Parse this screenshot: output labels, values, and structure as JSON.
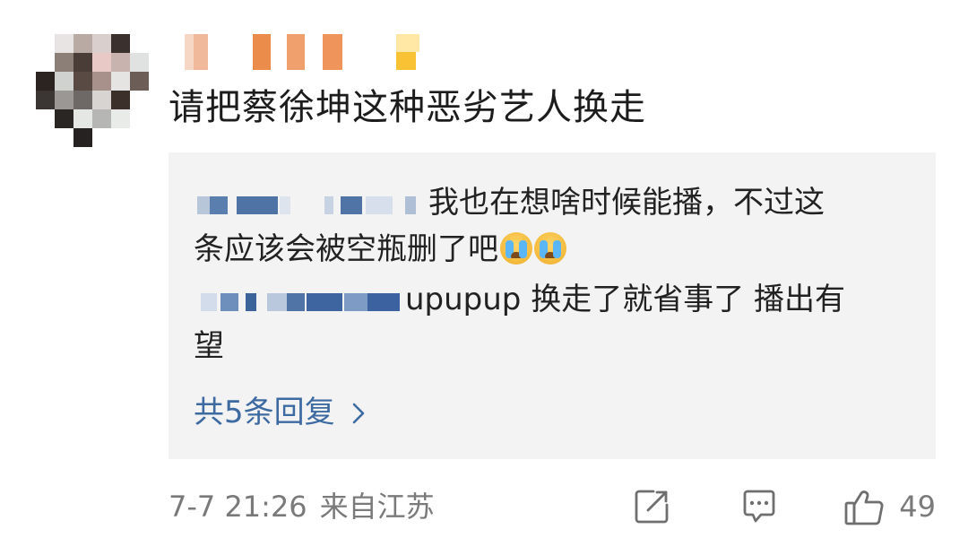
{
  "comment": {
    "text": "请把蔡徐坤这种恶劣艺人换走"
  },
  "replies": [
    {
      "text_line1": "我也在想啥时候能播，不过这",
      "text_line2": "条应该会被空瓶删了吧",
      "emoji": "crying-face-icon"
    },
    {
      "text_line1": "upupup 换走了就省事了 播出有",
      "text_line2": "望"
    }
  ],
  "more_replies_label": "共5条回复",
  "meta": {
    "time": "7-7 21:26",
    "source": "来自江苏"
  },
  "actions": {
    "share_icon": "share-icon",
    "comment_icon": "comment-icon",
    "like_icon": "thumbs-up-icon",
    "like_count": "49"
  },
  "colors": {
    "link": "#3d6aa1",
    "panel_bg": "#f3f3f4",
    "meta_gray": "#7a7a7a"
  }
}
